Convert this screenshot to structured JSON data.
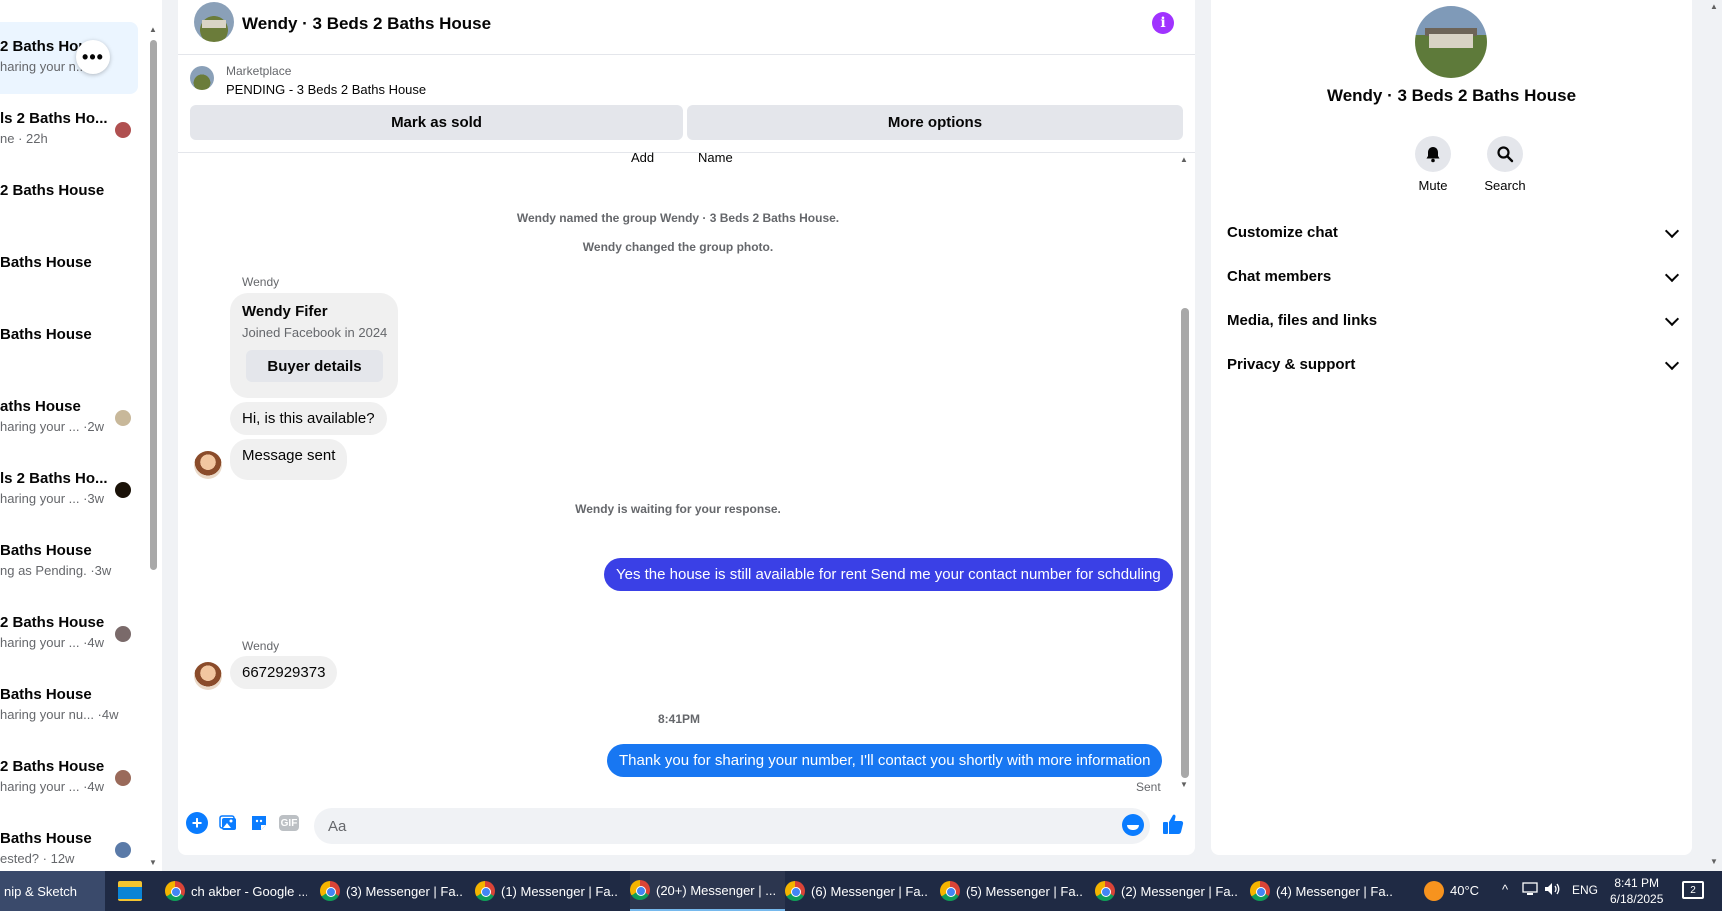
{
  "conversations": [
    {
      "title": "2 Baths House",
      "subtitle": "haring your n...m",
      "selected": true
    },
    {
      "title": "ls 2 Baths Ho...",
      "subtitle": "ne · 22h"
    },
    {
      "title": "2 Baths House",
      "subtitle": ""
    },
    {
      "title": "Baths House",
      "subtitle": ""
    },
    {
      "title": "Baths House",
      "subtitle": ""
    },
    {
      "title": "aths House",
      "subtitle": "haring your ... ·2w"
    },
    {
      "title": "ls 2 Baths Ho...",
      "subtitle": "haring your ... ·3w"
    },
    {
      "title": " Baths House",
      "subtitle": "ng as Pending. ·3w"
    },
    {
      "title": "2 Baths House",
      "subtitle": "haring your ... ·4w"
    },
    {
      "title": "Baths House",
      "subtitle": "haring your nu... ·4w"
    },
    {
      "title": "2 Baths House",
      "subtitle": "haring your ... ·4w"
    },
    {
      "title": "Baths House",
      "subtitle": "ested? · 12w"
    }
  ],
  "chat": {
    "title": "Wendy · 3 Beds 2 Baths House",
    "marketplace": {
      "label": "Marketplace",
      "status": "PENDING - 3 Beds 2 Baths House",
      "mark_sold_label": "Mark as sold",
      "more_options_label": "More options"
    },
    "top_labels": {
      "add": "Add",
      "name": "Name"
    },
    "system_messages": {
      "named": "Wendy named the group Wendy · 3 Beds 2 Baths House.",
      "photo": "Wendy changed the group photo.",
      "waiting": "Wendy is waiting for your response."
    },
    "sender_name": "Wendy",
    "profile_card": {
      "name": "Wendy Fifer",
      "joined": "Joined Facebook in 2024",
      "button_label": "Buyer details"
    },
    "incoming": {
      "msg1": "Hi, is this available?",
      "msg2": "Message sent",
      "msg3": "6672929373"
    },
    "outgoing": {
      "msg1": "Yes the house is still available for rent Send me your contact number for schduling",
      "msg2": "Thank you for sharing your number, I'll contact you shortly with more information"
    },
    "timestamp": "8:41PM",
    "sent_status": "Sent",
    "composer_placeholder": "Aa",
    "gif_label": "GIF"
  },
  "info_panel": {
    "group_name": "Wendy · 3 Beds 2 Baths House",
    "actions": {
      "mute": "Mute",
      "search": "Search"
    },
    "sections": [
      "Customize chat",
      "Chat members",
      "Media, files and links",
      "Privacy & support"
    ]
  },
  "taskbar": {
    "snip": "nip & Sketch",
    "items": [
      "ch akber - Google ...",
      "(3) Messenger | Fa...",
      "(1) Messenger | Fa...",
      "(20+) Messenger | ...",
      "(6) Messenger | Fa...",
      "(5) Messenger | Fa...",
      "(2) Messenger | Fa...",
      "(4) Messenger | Fa..."
    ],
    "weather": "40°C",
    "language": "ENG",
    "time": "8:41 PM",
    "date": "6/18/2025",
    "notification_count": "2"
  },
  "colors": {
    "outgoing_bubble": "#1877f2",
    "accent": "#0a7cff",
    "info_icon": "#a033ff"
  }
}
